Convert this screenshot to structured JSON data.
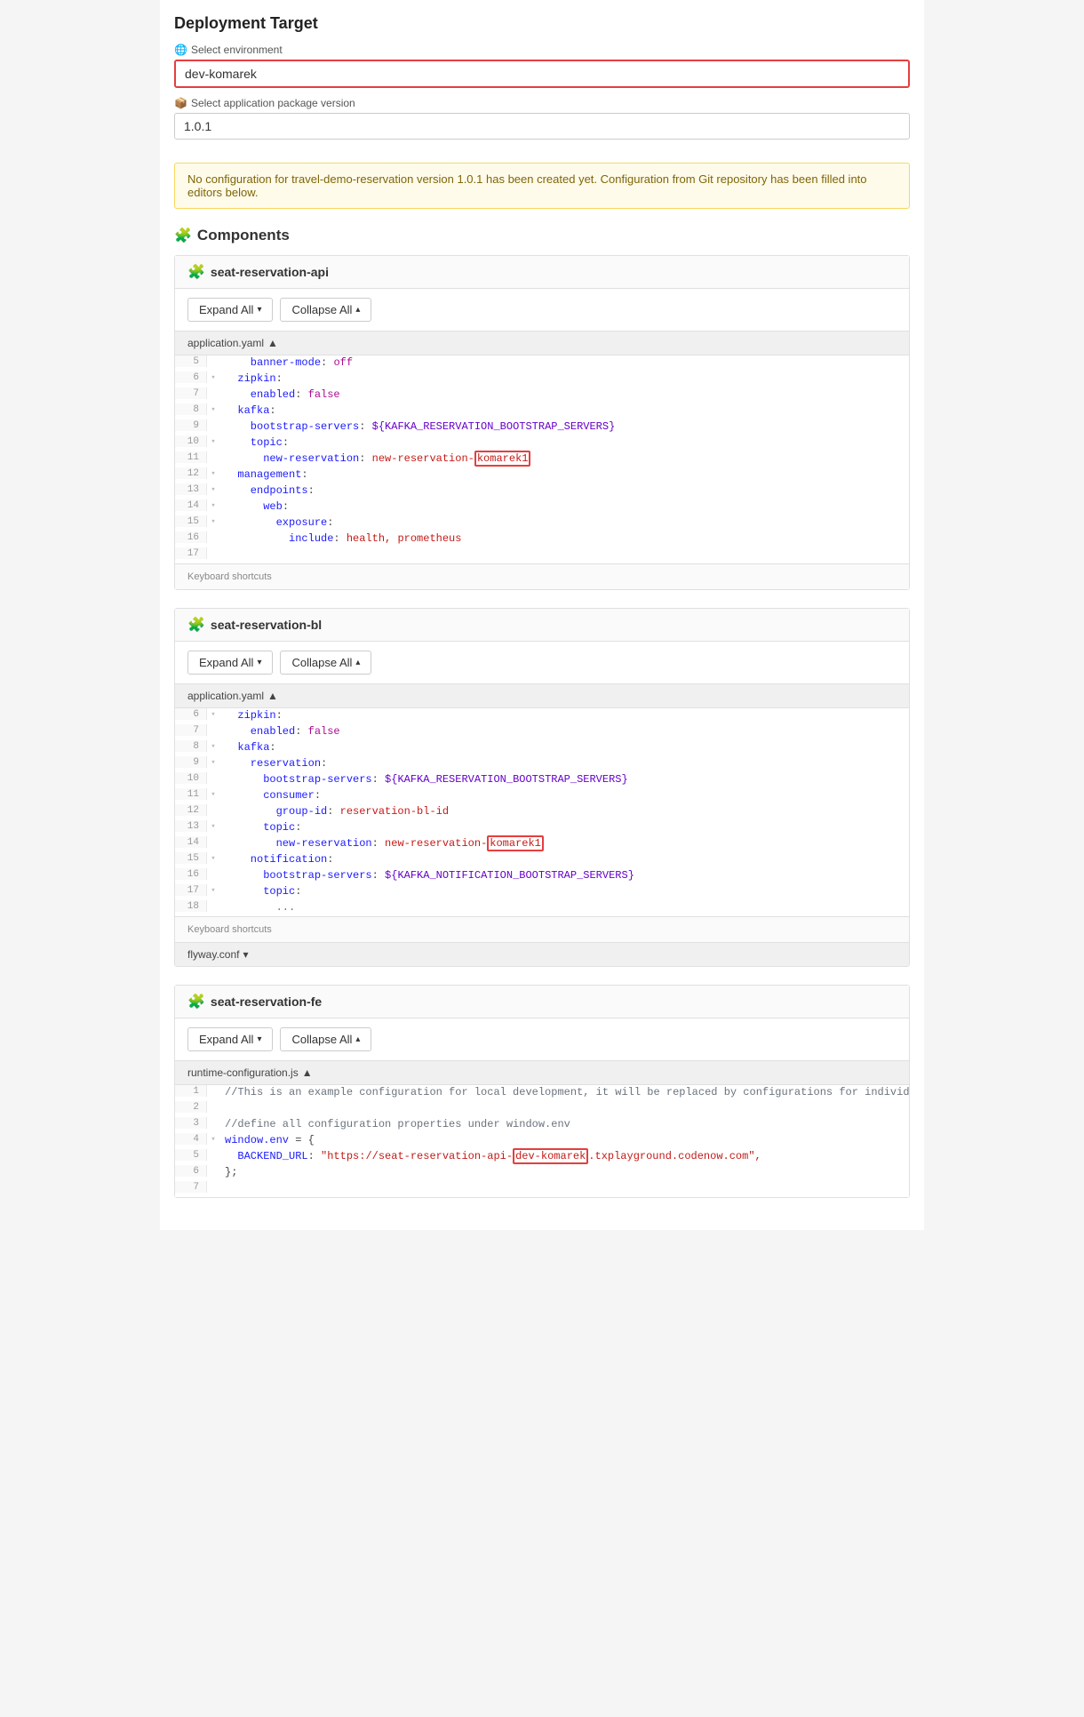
{
  "page": {
    "deployment_target_title": "Deployment Target",
    "environment_label": "Select environment",
    "environment_value": "dev-komarek",
    "version_label": "Select application package version",
    "version_value": "1.0.1",
    "warning_text": "No configuration for travel-demo-reservation version 1.0.1 has been created yet. Configuration from Git repository has been filled into editors below.",
    "components_title": "Components"
  },
  "components": [
    {
      "id": "seat-reservation-api",
      "name": "seat-reservation-api",
      "files": [
        {
          "name": "application.yaml",
          "arrow": "▲",
          "lines": [
            {
              "num": "5",
              "fold": "",
              "content": "    banner-mode: off",
              "type": "normal"
            },
            {
              "num": "6",
              "fold": "▾",
              "content": "  zipkin:",
              "type": "normal"
            },
            {
              "num": "7",
              "fold": "",
              "content": "    enabled: false",
              "type": "normal"
            },
            {
              "num": "8",
              "fold": "▾",
              "content": "  kafka:",
              "type": "normal"
            },
            {
              "num": "9",
              "fold": "",
              "content": "    bootstrap-servers: ${KAFKA_RESERVATION_BOOTSTRAP_SERVERS}",
              "type": "normal"
            },
            {
              "num": "10",
              "fold": "▾",
              "content": "    topic:",
              "type": "normal"
            },
            {
              "num": "11",
              "fold": "",
              "content": "      new-reservation: new-reservation-",
              "highlight": "komarek1",
              "type": "highlight"
            },
            {
              "num": "12",
              "fold": "▾",
              "content": "  management:",
              "type": "normal"
            },
            {
              "num": "13",
              "fold": "▾",
              "content": "    endpoints:",
              "type": "normal"
            },
            {
              "num": "14",
              "fold": "▾",
              "content": "      web:",
              "type": "normal"
            },
            {
              "num": "15",
              "fold": "▾",
              "content": "        exposure:",
              "type": "normal"
            },
            {
              "num": "16",
              "fold": "",
              "content": "          include: health, prometheus",
              "type": "normal"
            },
            {
              "num": "17",
              "fold": "",
              "content": "",
              "type": "normal"
            }
          ]
        }
      ]
    },
    {
      "id": "seat-reservation-bl",
      "name": "seat-reservation-bl",
      "files": [
        {
          "name": "application.yaml",
          "arrow": "▲",
          "lines": [
            {
              "num": "6",
              "fold": "▾",
              "content": "  zipkin:",
              "type": "normal"
            },
            {
              "num": "7",
              "fold": "",
              "content": "    enabled: false",
              "type": "normal"
            },
            {
              "num": "8",
              "fold": "▾",
              "content": "  kafka:",
              "type": "normal"
            },
            {
              "num": "9",
              "fold": "▾",
              "content": "    reservation:",
              "type": "normal"
            },
            {
              "num": "10",
              "fold": "",
              "content": "      bootstrap-servers: ${KAFKA_RESERVATION_BOOTSTRAP_SERVERS}",
              "type": "normal"
            },
            {
              "num": "11",
              "fold": "▾",
              "content": "      consumer:",
              "type": "normal"
            },
            {
              "num": "12",
              "fold": "",
              "content": "        group-id: reservation-bl-id",
              "type": "normal"
            },
            {
              "num": "13",
              "fold": "▾",
              "content": "      topic:",
              "type": "normal"
            },
            {
              "num": "14",
              "fold": "",
              "content": "        new-reservation: new-reservation-",
              "highlight": "komarek1",
              "type": "highlight"
            },
            {
              "num": "15",
              "fold": "▾",
              "content": "    notification:",
              "type": "normal"
            },
            {
              "num": "16",
              "fold": "",
              "content": "      bootstrap-servers: ${KAFKA_NOTIFICATION_BOOTSTRAP_SERVERS}",
              "type": "normal"
            },
            {
              "num": "17",
              "fold": "▾",
              "content": "      topic:",
              "type": "normal"
            },
            {
              "num": "18",
              "fold": "",
              "content": "        ...",
              "type": "normal"
            }
          ]
        },
        {
          "name": "flyway.conf",
          "arrow": "▾",
          "lines": []
        }
      ]
    },
    {
      "id": "seat-reservation-fe",
      "name": "seat-reservation-fe",
      "files": [
        {
          "name": "runtime-configuration.js",
          "arrow": "▲",
          "lines": [
            {
              "num": "1",
              "fold": "",
              "content": "//This is an example configuration for local development, it will be replaced by configurations for individual environments.",
              "type": "comment"
            },
            {
              "num": "2",
              "fold": "",
              "content": "",
              "type": "normal"
            },
            {
              "num": "3",
              "fold": "",
              "content": "//define all configuration properties under window.env",
              "type": "comment"
            },
            {
              "num": "4",
              "fold": "▾",
              "content": "window.env = {",
              "type": "normal"
            },
            {
              "num": "5",
              "fold": "",
              "content": "  BACKEND_URL: \"https://seat-reservation-api-",
              "highlight": "dev-komarek",
              "highlight_suffix": ".txplayground.codenow.com\",",
              "type": "highlight2"
            },
            {
              "num": "6",
              "fold": "",
              "content": "};",
              "type": "normal"
            },
            {
              "num": "7",
              "fold": "",
              "content": "",
              "type": "normal"
            }
          ]
        }
      ]
    }
  ],
  "labels": {
    "expand_all": "Expand All",
    "collapse_all": "Collapse All",
    "keyboard_shortcuts": "Keyboard shortcuts",
    "chevron_down": "▾",
    "chevron_up": "▴"
  }
}
